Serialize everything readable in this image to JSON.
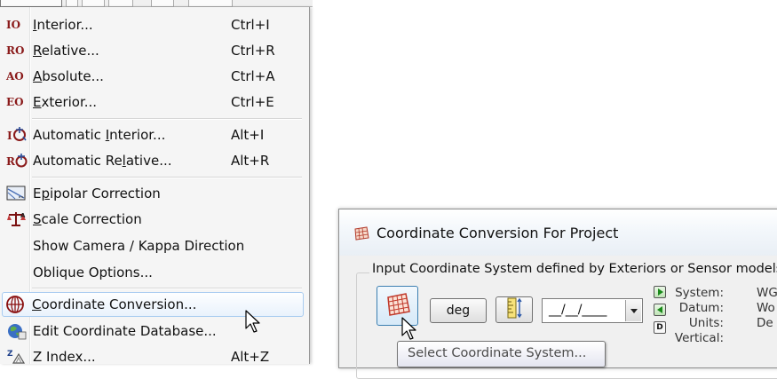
{
  "menu": {
    "items": [
      {
        "icon": "IO",
        "label_pre": "",
        "label_key": "I",
        "label_post": "nterior...",
        "shortcut": "Ctrl+I"
      },
      {
        "icon": "RO",
        "label_pre": "",
        "label_key": "R",
        "label_post": "elative...",
        "shortcut": "Ctrl+R"
      },
      {
        "icon": "AO",
        "label_pre": "",
        "label_key": "A",
        "label_post": "bsolute...",
        "shortcut": "Ctrl+A"
      },
      {
        "icon": "EO",
        "label_pre": "",
        "label_key": "E",
        "label_post": "xterior...",
        "shortcut": "Ctrl+E"
      },
      {
        "label_pre": "Automatic ",
        "label_key": "I",
        "label_post": "nterior...",
        "shortcut": "Alt+I"
      },
      {
        "label_pre": "Automatic Re",
        "label_key": "l",
        "label_post": "ative...",
        "shortcut": "Alt+R"
      },
      {
        "label_pre": "E",
        "label_key": "p",
        "label_post": "ipolar Correction"
      },
      {
        "label_pre": "",
        "label_key": "S",
        "label_post": "cale Correction"
      },
      {
        "label": "Show Camera / Kappa Direction"
      },
      {
        "label": "Oblique Options..."
      },
      {
        "label_pre": "",
        "label_key": "C",
        "label_post": "oordinate Conversion..."
      },
      {
        "label": "Edit Coordinate Database..."
      },
      {
        "label": "Z Index...",
        "shortcut": "Alt+Z"
      }
    ]
  },
  "dialog": {
    "title": "Coordinate Conversion For Project",
    "group_label": "Input Coordinate System defined by Exteriors or Sensor models",
    "deg_label": "deg",
    "date_value": "__/__/____",
    "tooltip": "Select Coordinate System...",
    "info": {
      "system_key": "System:",
      "system_val": "WG",
      "datum_key": "Datum:",
      "datum_val": "Wo",
      "units_key": "Units:",
      "units_val": "De",
      "vertical_key": "Vertical:"
    },
    "d_button": "D"
  }
}
